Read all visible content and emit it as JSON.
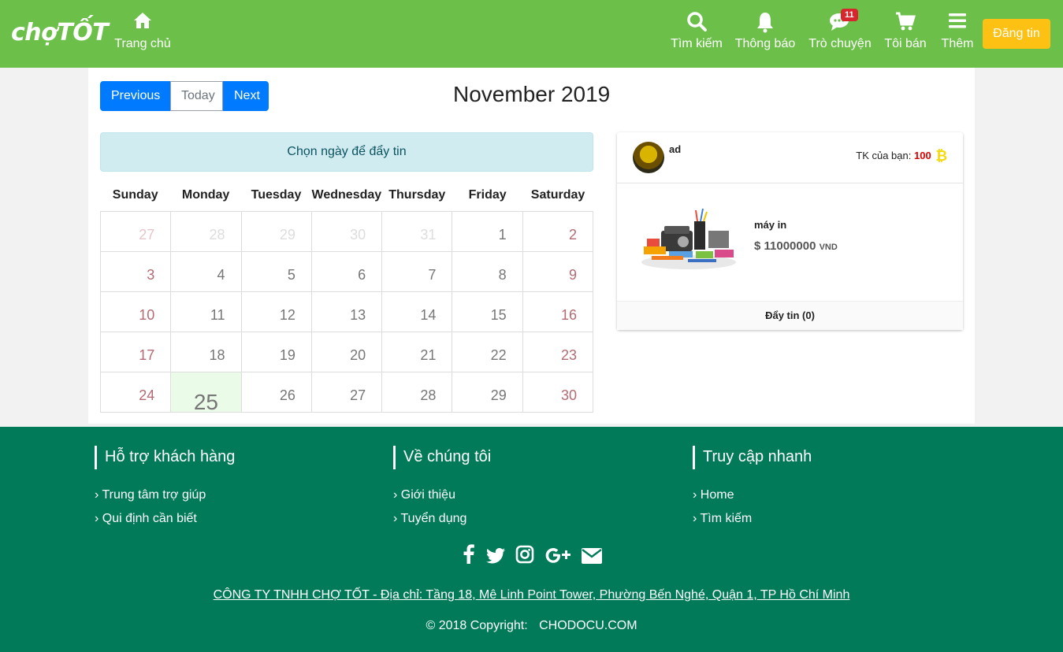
{
  "header": {
    "logo": "chợTỐT",
    "nav": {
      "home": "Trang chủ",
      "search": "Tìm kiếm",
      "notifications": "Thông báo",
      "chat": "Trò chuyện",
      "chat_badge": "11",
      "sell": "Tôi bán",
      "more": "Thêm"
    },
    "post_button": "Đăng tin"
  },
  "calendar": {
    "prev": "Previous",
    "today": "Today",
    "next": "Next",
    "title": "November 2019",
    "notice": "Chọn ngày để đẩy tin",
    "weekdays": [
      "Sunday",
      "Monday",
      "Tuesday",
      "Wednesday",
      "Thursday",
      "Friday",
      "Saturday"
    ],
    "weeks": [
      [
        "27",
        "28",
        "29",
        "30",
        "31",
        "1",
        "2"
      ],
      [
        "3",
        "4",
        "5",
        "6",
        "7",
        "8",
        "9"
      ],
      [
        "10",
        "11",
        "12",
        "13",
        "14",
        "15",
        "16"
      ],
      [
        "17",
        "18",
        "19",
        "20",
        "21",
        "22",
        "23"
      ],
      [
        "24",
        "25",
        "26",
        "27",
        "28",
        "29",
        "30"
      ]
    ],
    "highlighted": "25"
  },
  "card": {
    "user": "ad",
    "balance_label": "TK của bạn:",
    "balance_value": "100",
    "coin_icon": "bitcoin-icon",
    "product_name": "máy in",
    "product_price": "$ 11000000",
    "product_currency": "VND",
    "push_button": "Đẩy tin (0)"
  },
  "footer": {
    "support": {
      "title": "Hỗ trợ khách hàng",
      "links": [
        "Trung tâm trợ giúp",
        "Qui định cần biết"
      ]
    },
    "about": {
      "title": "Về chúng tôi",
      "links": [
        "Giới thiệu",
        "Tuyển dụng"
      ]
    },
    "quick": {
      "title": "Truy cập nhanh",
      "links": [
        "Home",
        "Tìm kiếm"
      ]
    },
    "social_icons": [
      "facebook-icon",
      "twitter-icon",
      "instagram-icon",
      "google-plus-icon",
      "email-icon"
    ],
    "company": "CÔNG TY TNHH CHỢ TỐT - Địa chỉ: Tầng 18, Mê Linh Point Tower, Phường Bến Nghé, Quận 1, TP Hồ Chí Minh",
    "copyright": "© 2018 Copyright:",
    "site": "CHODOCU.COM"
  },
  "colors": {
    "header": "#6cc04a",
    "footer": "#007a59",
    "primary_button": "#007bff",
    "post_button": "#fdc113",
    "highlight_day": "#eafbe7"
  }
}
